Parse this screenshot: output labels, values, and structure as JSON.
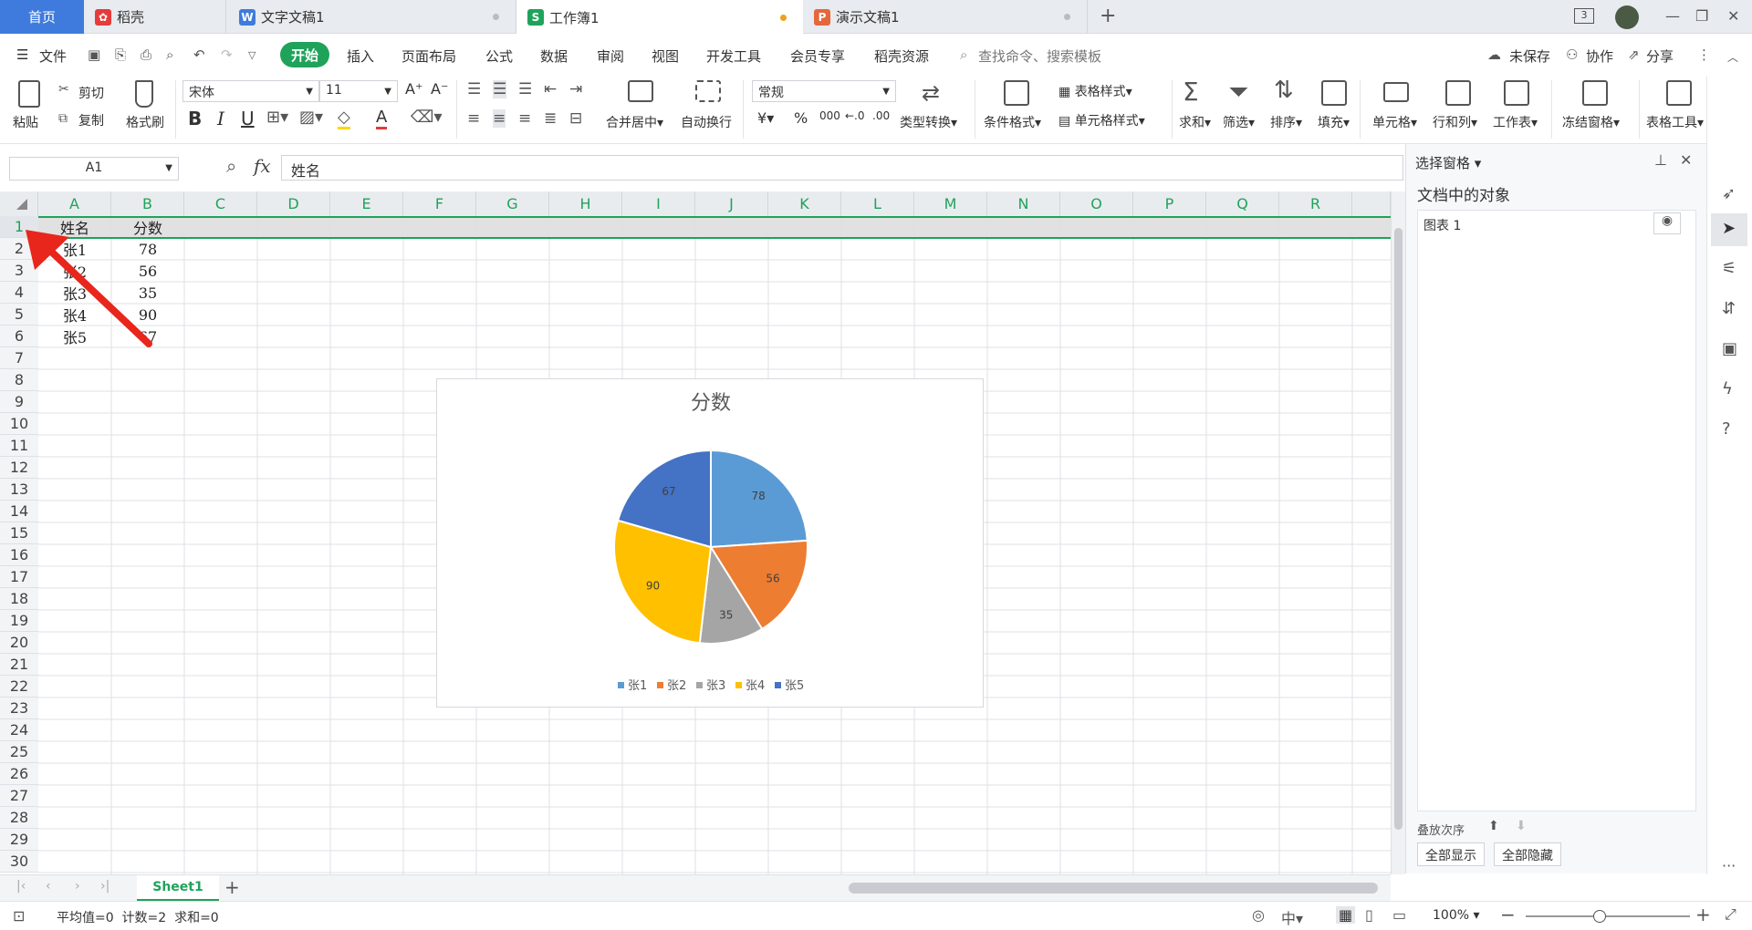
{
  "tabs": {
    "home": "首页",
    "daoke": "稻壳",
    "doc": "文字文稿1",
    "book": "工作簿1",
    "ppt": "演示文稿1",
    "window_count": "3"
  },
  "menu": {
    "file": "文件",
    "start": "开始",
    "items": [
      "插入",
      "页面布局",
      "公式",
      "数据",
      "审阅",
      "视图",
      "开发工具",
      "会员专享",
      "稻壳资源"
    ],
    "search_placeholder": "查找命令、搜索模板",
    "unsaved": "未保存",
    "collab": "协作",
    "share": "分享"
  },
  "ribbon": {
    "paste": "粘贴",
    "cut": "剪切",
    "copy": "复制",
    "format_painter": "格式刷",
    "font_name": "宋体",
    "font_size": "11",
    "merge_center": "合并居中",
    "wrap": "自动换行",
    "number_format": "常规",
    "type_convert": "类型转换",
    "cond_format": "条件格式",
    "table_style": "表格样式",
    "cell_style": "单元格样式",
    "sum": "求和",
    "filter": "筛选",
    "sort": "排序",
    "fill": "填充",
    "cell": "单元格",
    "rowcol": "行和列",
    "worksheet": "工作表",
    "freeze": "冻结窗格",
    "table_tools": "表格工具",
    "currency": "¥",
    "percent": "%",
    "thousands": "000"
  },
  "formula_bar": {
    "name_box": "A1",
    "fx": "fx",
    "content": "姓名"
  },
  "sheet": {
    "columns": [
      "A",
      "B",
      "C",
      "D",
      "E",
      "F",
      "G",
      "H",
      "I",
      "J",
      "K",
      "L",
      "M",
      "N",
      "O",
      "P",
      "Q",
      "R"
    ],
    "rows": [
      "1",
      "2",
      "3",
      "4",
      "5",
      "6",
      "7",
      "8",
      "9",
      "10",
      "11",
      "12",
      "13",
      "14",
      "15",
      "16",
      "17",
      "18",
      "19",
      "20",
      "21",
      "22",
      "23",
      "24",
      "25",
      "26",
      "27",
      "28",
      "29",
      "30"
    ],
    "cells": {
      "A1": "姓名",
      "B1": "分数",
      "A2": "张1",
      "B2": "78",
      "A3": "张2",
      "B3": "56",
      "A4": "张3",
      "B4": "35",
      "A5": "张4",
      "B5": "90",
      "A6": "张5",
      "B6": "67"
    }
  },
  "chart_data": {
    "type": "pie",
    "title": "分数",
    "categories": [
      "张1",
      "张2",
      "张3",
      "张4",
      "张5"
    ],
    "values": [
      78,
      56,
      35,
      90,
      67
    ],
    "colors": [
      "#5b9bd5",
      "#ed7d31",
      "#a5a5a5",
      "#ffc000",
      "#4472c4"
    ],
    "legend_position": "bottom"
  },
  "right_panel": {
    "title": "选择窗格",
    "section": "文档中的对象",
    "object": "图表 1",
    "show_all": "全部显示",
    "hide_all": "全部隐藏",
    "order_label": "叠放次序"
  },
  "sheet_tab": "Sheet1",
  "status": {
    "summary": "平均值=0  计数=2  求和=0",
    "zoom": "100%"
  },
  "accent": "#1fa35b"
}
